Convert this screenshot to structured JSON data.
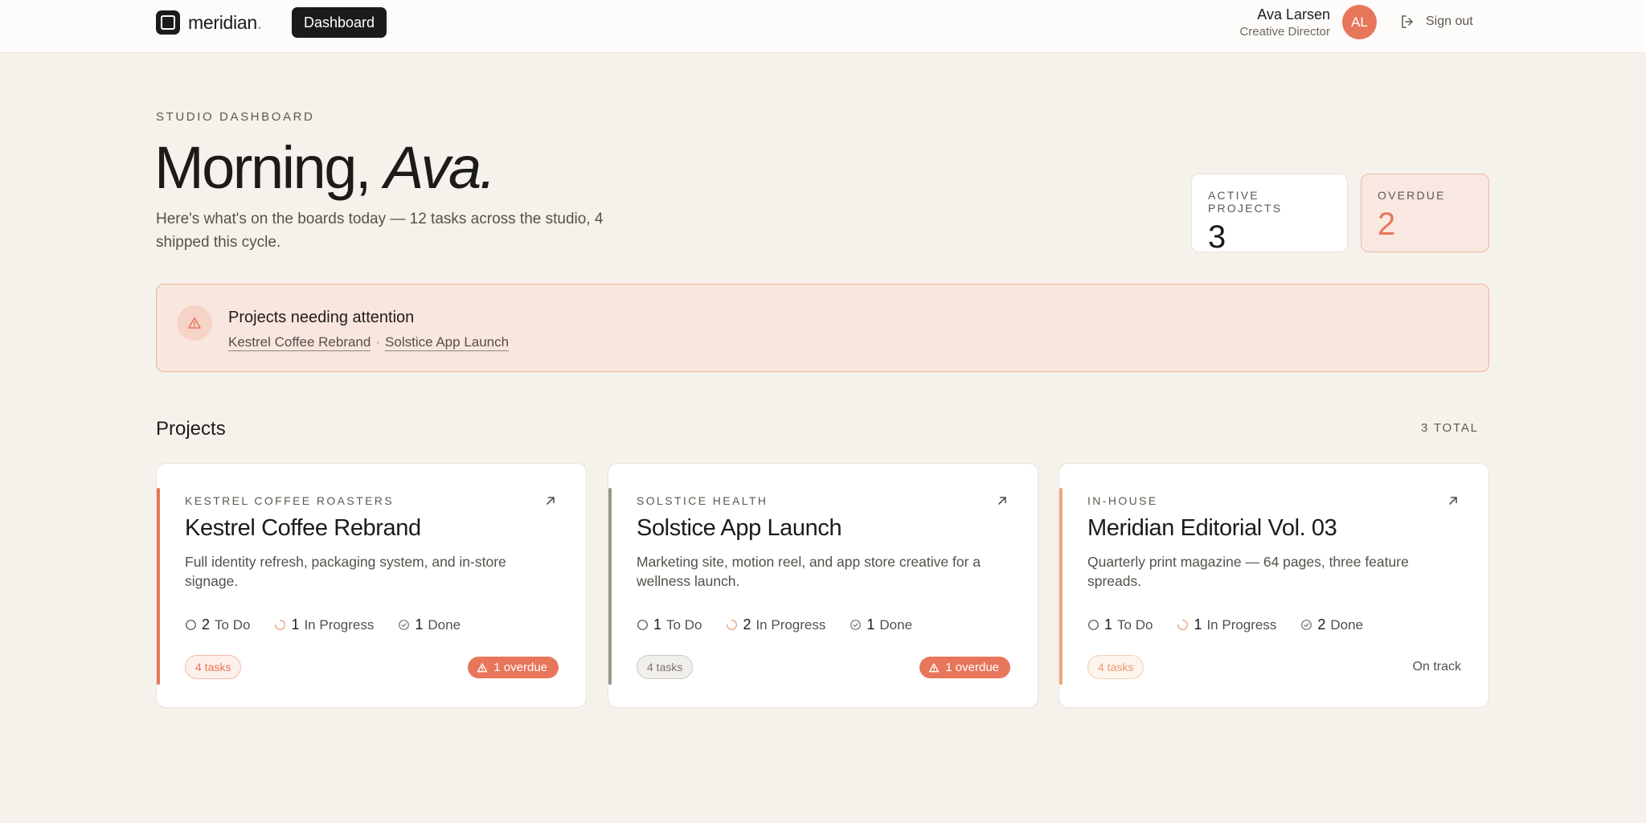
{
  "header": {
    "logo_text": "meridian",
    "logo_dot": ".",
    "nav_active": "Dashboard",
    "user": {
      "name": "Ava Larsen",
      "role": "Creative Director",
      "initials": "AL"
    },
    "signout_label": "Sign out"
  },
  "hero": {
    "eyebrow": "STUDIO DASHBOARD",
    "greeting_prefix": "Morning,",
    "greeting_name": "Ava.",
    "lede": "Here's what's on the boards today — 12 tasks across the studio, 4 shipped this cycle."
  },
  "stats": {
    "active": {
      "label": "ACTIVE PROJECTS",
      "value": "3"
    },
    "overdue": {
      "label": "OVERDUE",
      "value": "2"
    }
  },
  "alert": {
    "title": "Projects needing attention",
    "links": [
      "Kestrel Coffee Rebrand",
      "Solstice App Launch"
    ],
    "separator": "·"
  },
  "projects": {
    "title": "Projects",
    "total": "3 TOTAL",
    "items": [
      {
        "client": "KESTREL COFFEE ROASTERS",
        "name": "Kestrel Coffee Rebrand",
        "description": "Full identity refresh, packaging system, and in-store signage.",
        "todo": "2",
        "todo_label": "To Do",
        "inprogress": "1",
        "inprogress_label": "In Progress",
        "done": "1",
        "done_label": "Done",
        "tasks": "4 tasks",
        "status": "1 overdue",
        "accent": "#e8765a"
      },
      {
        "client": "SOLSTICE HEALTH",
        "name": "Solstice App Launch",
        "description": "Marketing site, motion reel, and app store creative for a wellness launch.",
        "todo": "1",
        "todo_label": "To Do",
        "inprogress": "2",
        "inprogress_label": "In Progress",
        "done": "1",
        "done_label": "Done",
        "tasks": "4 tasks",
        "status": "1 overdue",
        "accent": "#9a9a8c"
      },
      {
        "client": "IN-HOUSE",
        "name": "Meridian Editorial Vol. 03",
        "description": "Quarterly print magazine — 64 pages, three feature spreads.",
        "todo": "1",
        "todo_label": "To Do",
        "inprogress": "1",
        "inprogress_label": "In Progress",
        "done": "2",
        "done_label": "Done",
        "tasks": "4 tasks",
        "status": "On track",
        "accent": "#f0a77e"
      }
    ]
  },
  "colors": {
    "accent": "#e8765a",
    "ink": "#1c1b1a",
    "background": "#f5f2ec"
  }
}
